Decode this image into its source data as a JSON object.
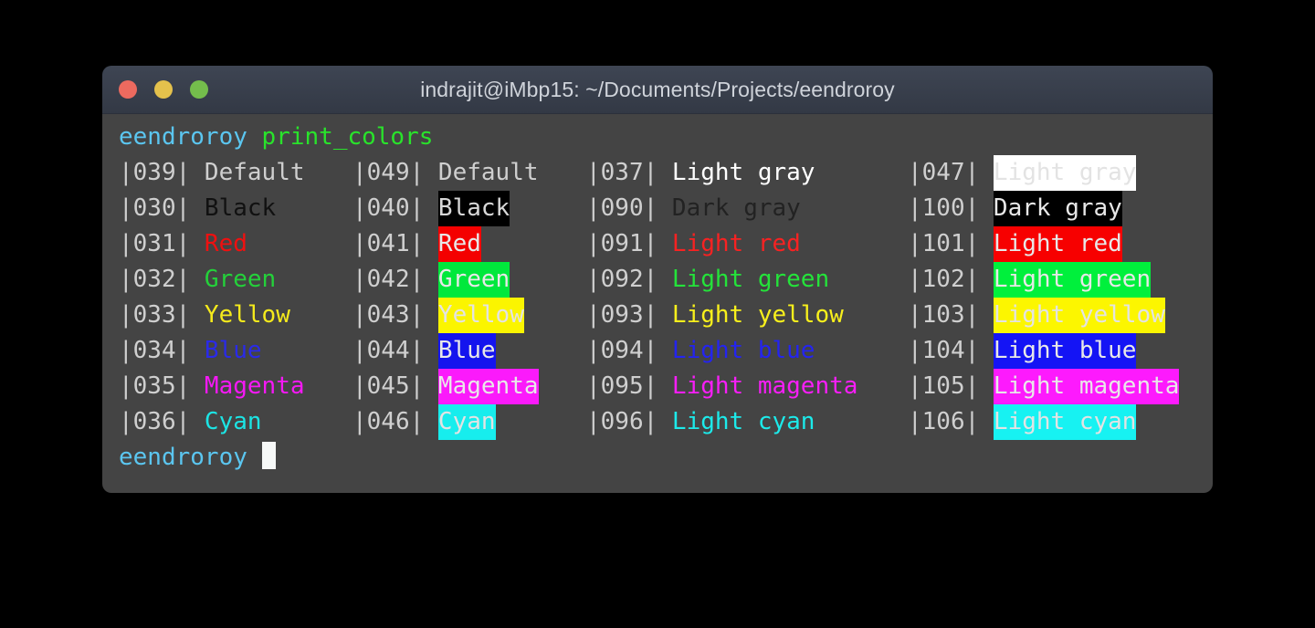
{
  "window": {
    "title": "indrajit@iMbp15: ~/Documents/Projects/eendroroy",
    "traffic_lights": [
      {
        "name": "close",
        "color": "#ec6a5f"
      },
      {
        "name": "minimize",
        "color": "#e4c14c"
      },
      {
        "name": "maximize",
        "color": "#74bd4c"
      }
    ],
    "background": "#444444",
    "titlebar_color": "#3e4553"
  },
  "terminal": {
    "command_line": {
      "user": "eendroroy",
      "user_color": "#5bc6f0",
      "command": "print_colors",
      "command_color": "#29e32b"
    },
    "final_prompt": {
      "user": "eendroroy",
      "user_color": "#5bc6f0",
      "cursor_color": "#f7f9f8"
    },
    "code_color": "#cfcfcf",
    "rows": [
      [
        {
          "code": "|039|",
          "label": "Default",
          "fg": "#cfcfcf",
          "bg": "none"
        },
        {
          "code": "|049|",
          "label": "Default",
          "fg": "#cfcfcf",
          "bg": "none"
        },
        {
          "code": "|037|",
          "label": "Light gray",
          "fg": "#ffffff",
          "bg": "none"
        },
        {
          "code": "|047|",
          "label": "Light gray",
          "fg": "#e3e3e3",
          "bg": "#ffffff"
        }
      ],
      [
        {
          "code": "|030|",
          "label": "Black",
          "fg": "#111111",
          "bg": "none"
        },
        {
          "code": "|040|",
          "label": "Black",
          "fg": "#d8d8d8",
          "bg": "#000000"
        },
        {
          "code": "|090|",
          "label": "Dark gray",
          "fg": "#222222",
          "bg": "none"
        },
        {
          "code": "|100|",
          "label": "Dark gray",
          "fg": "#e8e8e8",
          "bg": "#000000"
        }
      ],
      [
        {
          "code": "|031|",
          "label": "Red",
          "fg": "#f01010",
          "bg": "none"
        },
        {
          "code": "|041|",
          "label": "Red",
          "fg": "#e8e8e8",
          "bg": "#f40000"
        },
        {
          "code": "|091|",
          "label": "Light red",
          "fg": "#f72222",
          "bg": "none"
        },
        {
          "code": "|101|",
          "label": "Light red",
          "fg": "#e8e8e8",
          "bg": "#f70000"
        }
      ],
      [
        {
          "code": "|032|",
          "label": "Green",
          "fg": "#24d13a",
          "bg": "none"
        },
        {
          "code": "|042|",
          "label": "Green",
          "fg": "#e8e8e8",
          "bg": "#00e83c"
        },
        {
          "code": "|092|",
          "label": "Light green",
          "fg": "#24e33a",
          "bg": "none"
        },
        {
          "code": "|102|",
          "label": "Light green",
          "fg": "#e8e8e8",
          "bg": "#00f03c"
        }
      ],
      [
        {
          "code": "|033|",
          "label": "Yellow",
          "fg": "#f5ea1c",
          "bg": "none"
        },
        {
          "code": "|043|",
          "label": "Yellow",
          "fg": "#e3e3e3",
          "bg": "#fbf500"
        },
        {
          "code": "|093|",
          "label": "Light yellow",
          "fg": "#f8f01c",
          "bg": "none"
        },
        {
          "code": "|103|",
          "label": "Light yellow",
          "fg": "#e3e3e3",
          "bg": "#fcf600"
        }
      ],
      [
        {
          "code": "|034|",
          "label": "Blue",
          "fg": "#2a2ae8",
          "bg": "none"
        },
        {
          "code": "|044|",
          "label": "Blue",
          "fg": "#e8e8e8",
          "bg": "#1414ee"
        },
        {
          "code": "|094|",
          "label": "Light blue",
          "fg": "#2424f0",
          "bg": "none"
        },
        {
          "code": "|104|",
          "label": "Light blue",
          "fg": "#e8e8e8",
          "bg": "#1414f5"
        }
      ],
      [
        {
          "code": "|035|",
          "label": "Magenta",
          "fg": "#f618f6",
          "bg": "none"
        },
        {
          "code": "|045|",
          "label": "Magenta",
          "fg": "#e8e8e8",
          "bg": "#fb1afb"
        },
        {
          "code": "|095|",
          "label": "Light magenta",
          "fg": "#f81ef8",
          "bg": "none"
        },
        {
          "code": "|105|",
          "label": "Light magenta",
          "fg": "#e8e8e8",
          "bg": "#fd1afd"
        }
      ],
      [
        {
          "code": "|036|",
          "label": "Cyan",
          "fg": "#1ce4e4",
          "bg": "none"
        },
        {
          "code": "|046|",
          "label": "Cyan",
          "fg": "#e3e3e3",
          "bg": "#17eded"
        },
        {
          "code": "|096|",
          "label": "Light cyan",
          "fg": "#1ceaea",
          "bg": "none"
        },
        {
          "code": "|106|",
          "label": "Light cyan",
          "fg": "#e3e3e3",
          "bg": "#17f2f2"
        }
      ]
    ]
  }
}
